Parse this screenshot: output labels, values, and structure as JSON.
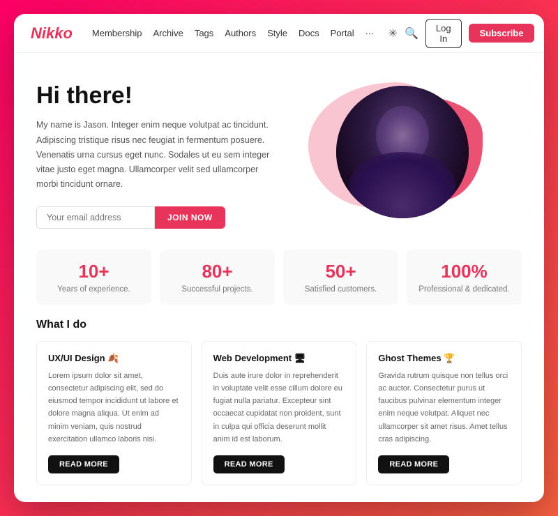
{
  "navbar": {
    "logo": "Nikko",
    "links": [
      {
        "label": "Membership"
      },
      {
        "label": "Archive"
      },
      {
        "label": "Tags"
      },
      {
        "label": "Authors"
      },
      {
        "label": "Style"
      },
      {
        "label": "Docs"
      },
      {
        "label": "Portal"
      },
      {
        "label": "···"
      }
    ],
    "login_label": "Log In",
    "subscribe_label": "Subscribe"
  },
  "hero": {
    "title": "Hi there!",
    "description": "My name is Jason. Integer enim neque volutpat ac tincidunt. Adipiscing tristique risus nec feugiat in fermentum posuere. Venenatis urna cursus eget nunc. Sodales ut eu sem integer vitae justo eget magna. Ullamcorper velit sed ullamcorper morbi tincidunt ornare.",
    "email_placeholder": "Your email address",
    "join_label": "JOIN NOW"
  },
  "stats": [
    {
      "number": "10+",
      "label": "Years of experience."
    },
    {
      "number": "80+",
      "label": "Successful projects."
    },
    {
      "number": "50+",
      "label": "Satisfied customers."
    },
    {
      "number": "100%",
      "label": "Professional & dedicated."
    }
  ],
  "what_section": {
    "title": "What I do",
    "cards": [
      {
        "title": "UX/UI Design 🍂",
        "description": "Lorem ipsum dolor sit amet, consectetur adipiscing elit, sed do eiusmod tempor incididunt ut labore et dolore magna aliqua. Ut enim ad minim veniam, quis nostrud exercitation ullamco laboris nisi.",
        "button": "READ MORE"
      },
      {
        "title": "Web Development 🖥",
        "description": "Duis aute irure dolor in reprehenderit in voluptate velit esse cillum dolore eu fugiat nulla pariatur. Excepteur sint occaecat cupidatat non proident, sunt in culpa qui officia deserunt mollit anim id est laborum.",
        "button": "READ MORE"
      },
      {
        "title": "Ghost Themes 🏆",
        "description": "Gravida rutrum quisque non tellus orci ac auctor. Consectetur purus ut faucibus pulvinar elementum integer enim neque volutpat. Aliquet nec ullamcorper sit amet risus. Amet tellus cras adipiscing.",
        "button": "READ MORE"
      }
    ]
  }
}
